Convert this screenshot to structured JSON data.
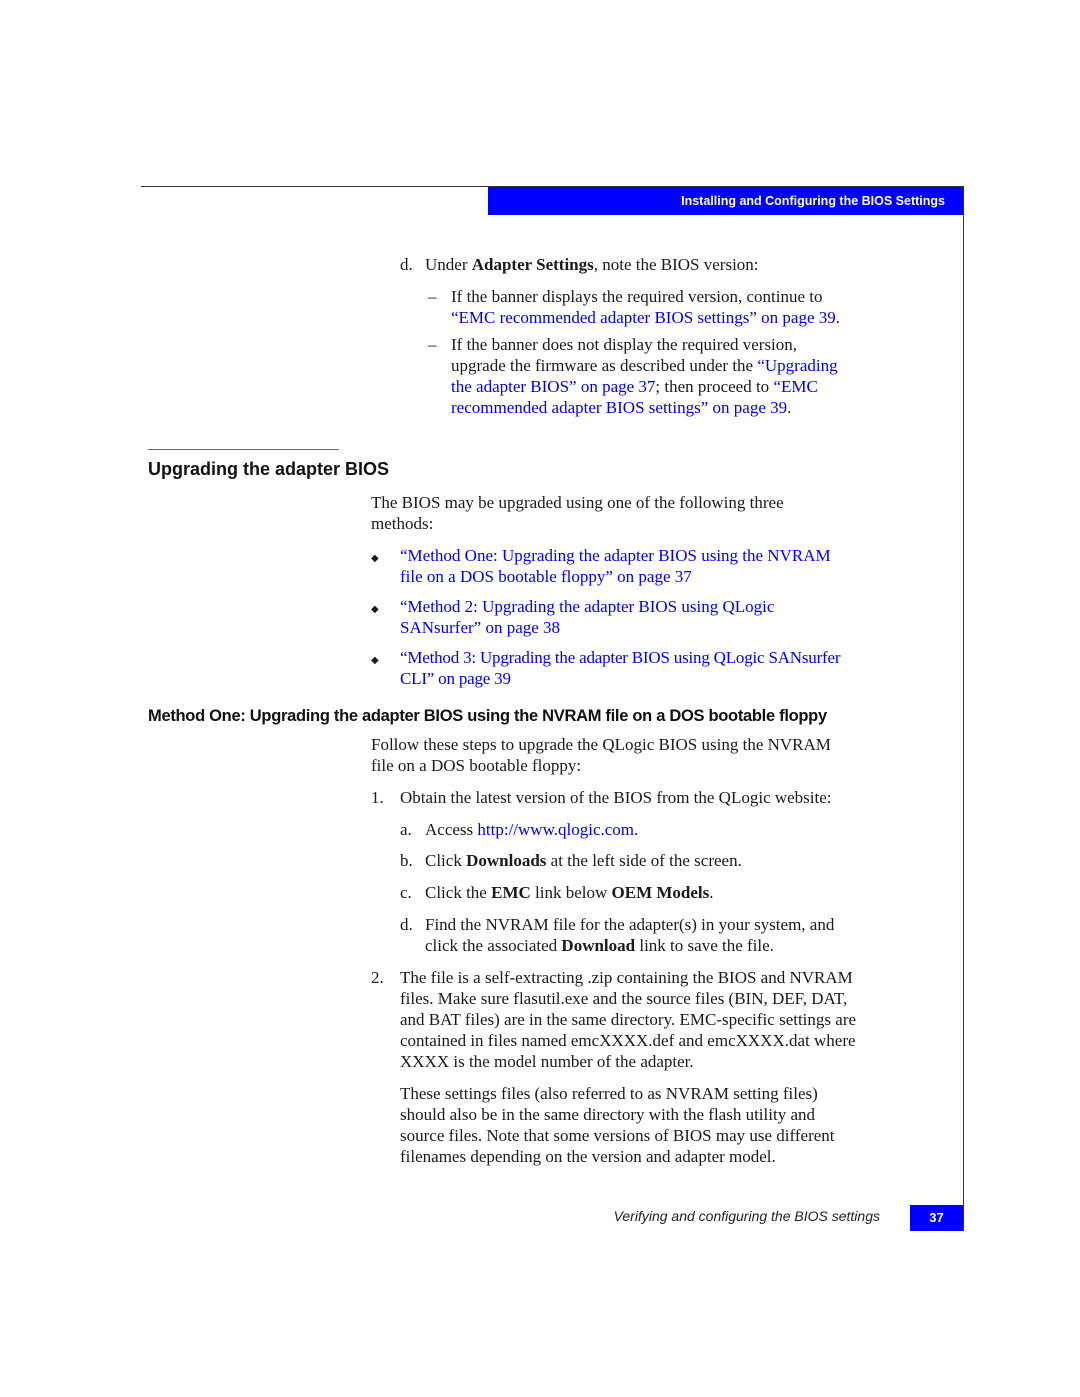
{
  "header": {
    "title": "Installing and Configuring the BIOS Settings"
  },
  "step_d_top": {
    "marker": "d.",
    "pre": "Under ",
    "bold": "Adapter Settings",
    "post": ", note the BIOS version:",
    "dashes": [
      {
        "marker": "–",
        "line1": "If the banner displays the required version, continue to",
        "link1": "“EMC recommended adapter BIOS settings” on page 39",
        "after": "."
      },
      {
        "marker": "–",
        "line1": "If the banner does not display the required version,",
        "line2_pre": "upgrade the firmware as described under the ",
        "link_a_1": "“Upgrading",
        "link_a_2": "the adapter BIOS” on page 37",
        "mid": "; then proceed to ",
        "link_b_1": "“EMC",
        "link_b_2": "recommended adapter BIOS settings” on page 39",
        "after": "."
      }
    ]
  },
  "section1": {
    "heading": "Upgrading the adapter BIOS",
    "intro_line1": "The BIOS may be upgraded using one of the following three",
    "intro_line2": "methods:",
    "bullets": [
      {
        "line1": "“Method One: Upgrading the adapter BIOS using the NVRAM",
        "line2": "file on a DOS bootable floppy” on page 37"
      },
      {
        "line1": "“Method 2: Upgrading the adapter BIOS using QLogic",
        "line2": "SANsurfer” on page 38"
      },
      {
        "line1": "“Method 3: Upgrading the adapter BIOS using QLogic SANsurfer",
        "line2": "CLI” on page 39"
      }
    ],
    "bullet_glyph": "◆"
  },
  "section2": {
    "heading": "Method One: Upgrading the adapter BIOS using the NVRAM file on a DOS bootable floppy",
    "intro_line1": "Follow these steps to upgrade the QLogic BIOS using the NVRAM",
    "intro_line2": "file on a DOS bootable floppy:",
    "step1": {
      "marker": "1.",
      "text": "Obtain the latest version of the BIOS from the QLogic website:",
      "a": {
        "marker": "a.",
        "pre": "Access ",
        "link": "http://www.qlogic.com",
        "post": "."
      },
      "b": {
        "marker": "b.",
        "pre": "Click ",
        "bold": "Downloads",
        "post": " at the left side of the screen."
      },
      "c": {
        "marker": "c.",
        "pre": "Click the ",
        "bold1": "EMC",
        "mid": " link below ",
        "bold2": "OEM Models",
        "post": "."
      },
      "d": {
        "marker": "d.",
        "line1": "Find the NVRAM file for the adapter(s) in your system, and",
        "pre2": "click the associated ",
        "bold": "Download",
        "post2": " link to save the file."
      }
    },
    "step2": {
      "marker": "2.",
      "lines": [
        "The file is a self-extracting .zip containing the BIOS and NVRAM",
        "files. Make sure flasutil.exe and the source files (BIN, DEF, DAT,",
        "and BAT files) are in the same directory. EMC-specific settings are",
        "contained in files named emcXXXX.def and emcXXXX.dat where",
        "XXXX is the model number of the adapter."
      ],
      "para_lines": [
        "These settings files (also referred to as NVRAM setting files)",
        "should also be in the same directory with the flash utility and",
        "source files. Note that some versions of BIOS may use different",
        "filenames depending on the version and adapter model."
      ]
    }
  },
  "footer": {
    "section_title": "Verifying and configuring the BIOS settings",
    "page_number": "37"
  }
}
